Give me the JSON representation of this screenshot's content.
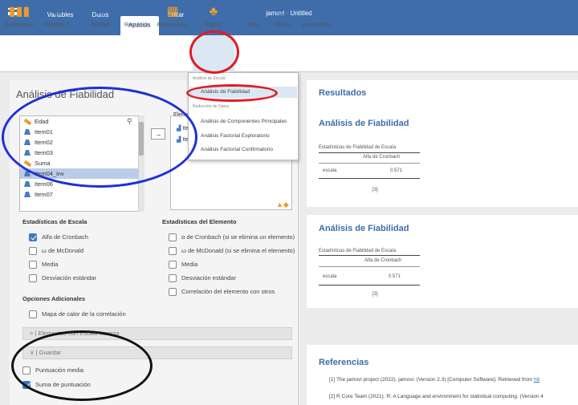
{
  "window_title": "jamovi - Untitled",
  "tabs": [
    "Variables",
    "Datos",
    "Análisis",
    "Editar"
  ],
  "active_tab": "Análisis",
  "ribbon": [
    "Exploración",
    "Pruebas T",
    "ANOVA",
    "Regresión",
    "Frecuencias",
    "Factor",
    "SEM",
    "PFDA",
    "snowLatent"
  ],
  "dropdown": {
    "group1": "Análisis de Escala",
    "item1": "Análisis de Fiabilidad",
    "group2": "Reducción de Datos",
    "item2": "Análisis de Componentes Principales",
    "item3": "Análisis Factorial Exploratorio",
    "item4": "Análisis Factorial Confirmatorio"
  },
  "panel_title": "Análisis de Fiabilidad",
  "variables": [
    "Edad",
    "Item01",
    "Item02",
    "Item03",
    "Suma",
    "Item04_inv",
    "Item06",
    "Item07"
  ],
  "elements_label": "Elementos",
  "elements_items": [
    "Ite",
    "Ite"
  ],
  "scale_stats": {
    "header": "Estadísticas de Escala",
    "items": [
      "Alfa de Cronbach",
      "ω de McDonald",
      "Media",
      "Desviación estándar"
    ],
    "checked": [
      true,
      false,
      false,
      false
    ]
  },
  "item_stats": {
    "header": "Estadísticas del Elemento",
    "items": [
      "α de Cronbach (si se elimina un elemento)",
      "ω de McDonald (si se elimina el elemento)",
      "Media",
      "Desviación estándar",
      "Correlación del elemento con otros"
    ]
  },
  "additional": {
    "header": "Opciones Adicionales",
    "heatmap": "Mapa de calor de la correlación"
  },
  "reverse_section": "> | Elementos con Escala Inversa",
  "save_section": "∨ | Guardar",
  "save_options": {
    "items": [
      "Puntuación media",
      "Suma de puntuación"
    ],
    "checked": [
      false,
      true
    ]
  },
  "results": {
    "title": "Resultados",
    "analysis_title": "Análisis de Fiabilidad",
    "table_caption": "Estadísticas de Fiabilidad de Escala",
    "col_header": "Alfa de Cronbach",
    "row_label": "escala",
    "value": "0.571",
    "note": "[3]"
  },
  "references": {
    "title": "Referencias",
    "ref1_num": "[1]",
    "ref1": "The jamovi project (2022). jamovi. (Version 2.3) [Computer Software]. Retrieved from ",
    "ref1_link": "htt",
    "ref2_num": "[2]",
    "ref2": "R Core Team (2021). R: A Language and environment for statistical computing. (Version 4"
  },
  "colors": {
    "topbar": "#3e6da9",
    "accent": "#3e6da9",
    "annotation_red": "#e01b24",
    "annotation_blue": "#1f2fd8",
    "annotation_black": "#111111"
  }
}
